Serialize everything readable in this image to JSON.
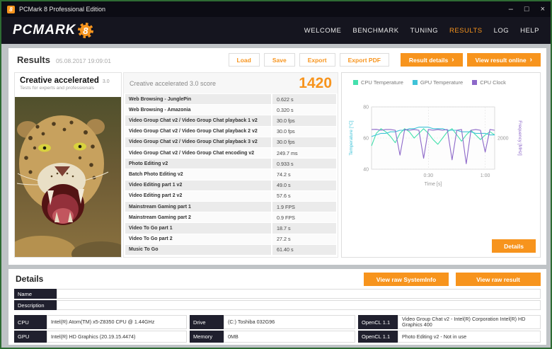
{
  "window": {
    "title": "PCMark 8 Professional Edition",
    "minimize": "–",
    "maximize": "□",
    "close": "×",
    "icon_digit": "8"
  },
  "icons": {
    "chevron_right": "›"
  },
  "nav": {
    "brand": "PCMARK",
    "brand_digit": "8",
    "items": [
      {
        "label": "WELCOME"
      },
      {
        "label": "BENCHMARK"
      },
      {
        "label": "TUNING"
      },
      {
        "label": "RESULTS"
      },
      {
        "label": "LOG"
      },
      {
        "label": "HELP"
      }
    ]
  },
  "results": {
    "title": "Results",
    "timestamp": "05.08.2017 19:09:01",
    "load": "Load",
    "save": "Save",
    "export": "Export",
    "export_pdf": "Export PDF",
    "result_details": "Result details",
    "view_result_online": "View result online"
  },
  "test_card": {
    "title": "Creative accelerated",
    "version": "3.0",
    "subtitle": "Tests for experts and professionals"
  },
  "score_panel": {
    "title": "Creative accelerated 3.0 score",
    "score": "1420",
    "rows": [
      {
        "label": "Web Browsing - JunglePin",
        "value": "0.622 s"
      },
      {
        "label": "Web Browsing - Amazonia",
        "value": "0.320 s"
      },
      {
        "label": "Video Group Chat v2 / Video Group Chat playback 1 v2",
        "value": "30.0 fps"
      },
      {
        "label": "Video Group Chat v2 / Video Group Chat playback 2 v2",
        "value": "30.0 fps"
      },
      {
        "label": "Video Group Chat v2 / Video Group Chat playback 3 v2",
        "value": "30.0 fps"
      },
      {
        "label": "Video Group Chat v2 / Video Group Chat encoding v2",
        "value": "249.7 ms"
      },
      {
        "label": "Photo Editing v2",
        "value": "0.933 s"
      },
      {
        "label": "Batch Photo Editing v2",
        "value": "74.2 s"
      },
      {
        "label": "Video Editing part 1 v2",
        "value": "49.0 s"
      },
      {
        "label": "Video Editing part 2 v2",
        "value": "57.6 s"
      },
      {
        "label": "Mainstream Gaming part 1",
        "value": "1.9 FPS"
      },
      {
        "label": "Mainstream Gaming part 2",
        "value": "0.9 FPS"
      },
      {
        "label": "Video To Go part 1",
        "value": "18.7 s"
      },
      {
        "label": "Video To Go part 2",
        "value": "27.2 s"
      },
      {
        "label": "Music To Go",
        "value": "61.40 s"
      }
    ]
  },
  "chart_data": {
    "type": "line",
    "xlabel": "Time [s]",
    "ylabel_left": "Temperature [°C]",
    "ylabel_right": "Frequency [MHz]",
    "x_max": 65,
    "x_step": 2.5,
    "x_ticks": [
      {
        "t": 30,
        "label": "0:30"
      },
      {
        "t": 60,
        "label": "1:00"
      }
    ],
    "temp_axis": {
      "min": 40,
      "max": 80,
      "ticks": [
        40,
        60,
        80
      ]
    },
    "freq_axis": {
      "min": 0,
      "max": 4000,
      "ticks": [
        2000
      ]
    },
    "legend": [
      "CPU Temperature",
      "GPU Temperature",
      "CPU Clock"
    ],
    "series": [
      {
        "name": "CPU Temperature",
        "axis": "temp",
        "color": "#45e0ad",
        "values": [
          55,
          63,
          66,
          64,
          61,
          57,
          63,
          66,
          64,
          60,
          63,
          66,
          63,
          59,
          56,
          60,
          64,
          66,
          62,
          58,
          62,
          65,
          62,
          59,
          62,
          64,
          62
        ]
      },
      {
        "name": "GPU Temperature",
        "axis": "temp",
        "color": "#3fc3d8",
        "values": [
          61,
          62,
          63,
          63,
          64,
          64,
          65,
          65,
          66,
          66,
          67,
          67,
          67,
          66,
          66,
          66,
          65,
          65,
          65,
          64,
          64,
          64,
          63,
          63,
          63,
          62,
          62
        ]
      },
      {
        "name": "CPU Clock",
        "axis": "freq",
        "color": "#8d68c9",
        "values": [
          2550,
          2560,
          2500,
          2550,
          2550,
          2500,
          900,
          2550,
          2500,
          2550,
          2500,
          700,
          2550,
          2500,
          2550,
          2500,
          2550,
          600,
          2500,
          2550,
          350,
          2500,
          2550,
          2500,
          1100,
          2550,
          2500
        ]
      }
    ],
    "details_button": "Details"
  },
  "details": {
    "title": "Details",
    "view_raw_systeminfo": "View raw SystemInfo",
    "view_raw_result": "View raw result",
    "name_label": "Name",
    "name_value": "",
    "description_label": "Description",
    "description_value": "",
    "cpu_label": "CPU",
    "cpu_value": "Intel(R) Atom(TM) x5-Z8350  CPU @ 1.44GHz",
    "gpu_label": "GPU",
    "gpu_value": "Intel(R) HD Graphics (20.19.15.4474)",
    "drive_label": "Drive",
    "drive_value": "(C:) Toshiba 032G96",
    "memory_label": "Memory",
    "memory_value": "0MB",
    "opencl1_label": "OpenCL 1.1",
    "opencl1_value": "Video Group Chat v2 - Intel(R) Corporation Intel(R) HD Graphics 400",
    "opencl2_label": "OpenCL 1.1",
    "opencl2_value": "Photo Editing v2 - Not in use"
  }
}
